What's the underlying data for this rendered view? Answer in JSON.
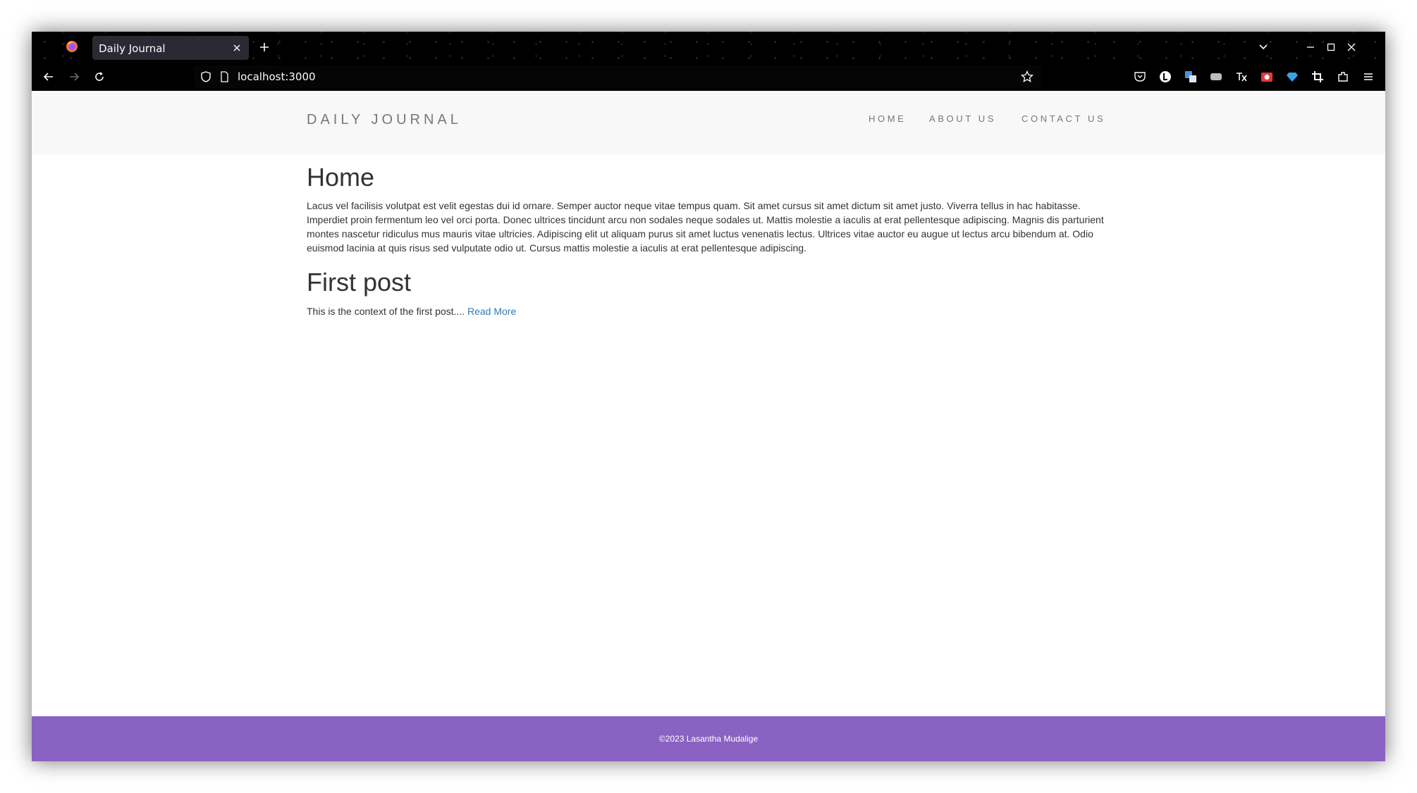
{
  "browser": {
    "tab_title": "Daily Journal",
    "url": "localhost:3000"
  },
  "site": {
    "brand": "DAILY JOURNAL",
    "nav": [
      "HOME",
      "ABOUT US",
      "CONTACT US"
    ]
  },
  "home": {
    "heading": "Home",
    "paragraph": "Lacus vel facilisis volutpat est velit egestas dui id ornare. Semper auctor neque vitae tempus quam. Sit amet cursus sit amet dictum sit amet justo. Viverra tellus in hac habitasse. Imperdiet proin fermentum leo vel orci porta. Donec ultrices tincidunt arcu non sodales neque sodales ut. Mattis molestie a iaculis at erat pellentesque adipiscing. Magnis dis parturient montes nascetur ridiculus mus mauris vitae ultricies. Adipiscing elit ut aliquam purus sit amet luctus venenatis lectus. Ultrices vitae auctor eu augue ut lectus arcu bibendum at. Odio euismod lacinia at quis risus sed vulputate odio ut. Cursus mattis molestie a iaculis at erat pellentesque adipiscing."
  },
  "posts": [
    {
      "title": "First post",
      "excerpt": "This is the context of the first post.... ",
      "read_more": "Read More"
    }
  ],
  "footer": {
    "text": "©2023 Lasantha Mudalige"
  },
  "colors": {
    "footer_bg": "#8a62c2",
    "header_bg": "#f8f8f8",
    "link": "#337ab7",
    "browser_chrome": "#000000"
  },
  "icons": [
    "firefox-logo-icon",
    "close-icon",
    "plus-icon",
    "chevron-down-icon",
    "minimize-icon",
    "maximize-icon",
    "back-arrow-icon",
    "forward-arrow-icon",
    "reload-icon",
    "shield-icon",
    "page-icon",
    "star-icon",
    "pocket-icon",
    "extension-icons",
    "menu-icon"
  ]
}
